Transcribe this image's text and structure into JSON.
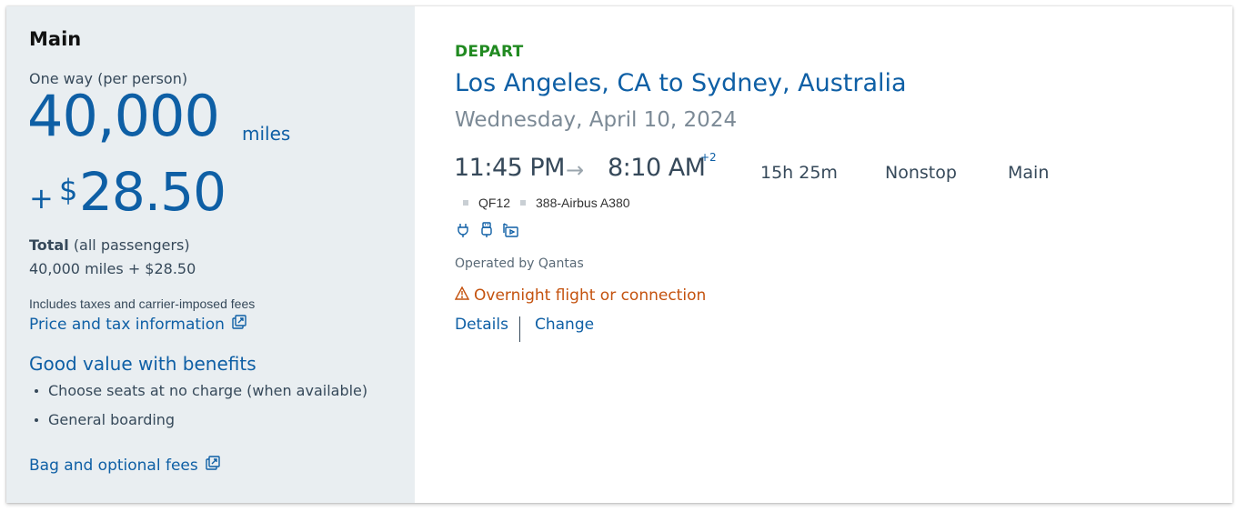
{
  "fare": {
    "name": "Main",
    "trip_type": "One way (per person)",
    "miles": "40,000",
    "miles_unit": "miles",
    "plus": "+",
    "currency_symbol": "$",
    "amount": "28.50",
    "total_label": "Total",
    "total_suffix": "(all passengers)",
    "total_value": "40,000 miles + $28.50",
    "includes_text": "Includes taxes and carrier-imposed fees",
    "price_tax_link": "Price and tax information",
    "benefits_title": "Good value with benefits",
    "benefits": [
      "Choose seats at no charge (when available)",
      "General boarding"
    ],
    "bag_link": "Bag and optional fees"
  },
  "flight": {
    "label": "DEPART",
    "route": "Los Angeles, CA to Sydney, Australia",
    "date": "Wednesday, April 10, 2024",
    "depart_time": "11:45 PM",
    "arrive_time": "8:10 AM",
    "day_offset": "+2",
    "duration": "15h 25m",
    "stops": "Nonstop",
    "cabin": "Main",
    "flight_number": "QF12",
    "aircraft": "388-Airbus A380",
    "amenity_icons": [
      "power-outlet-icon",
      "usb-icon",
      "entertainment-icon"
    ],
    "operated_by": "Operated by Qantas",
    "warning": "Overnight flight or connection",
    "details_link": "Details",
    "change_link": "Change"
  },
  "colors": {
    "brand_blue": "#0e5fa5",
    "depart_green": "#218a21",
    "warning_orange": "#c4520e",
    "left_panel_bg": "#e9eef1"
  }
}
